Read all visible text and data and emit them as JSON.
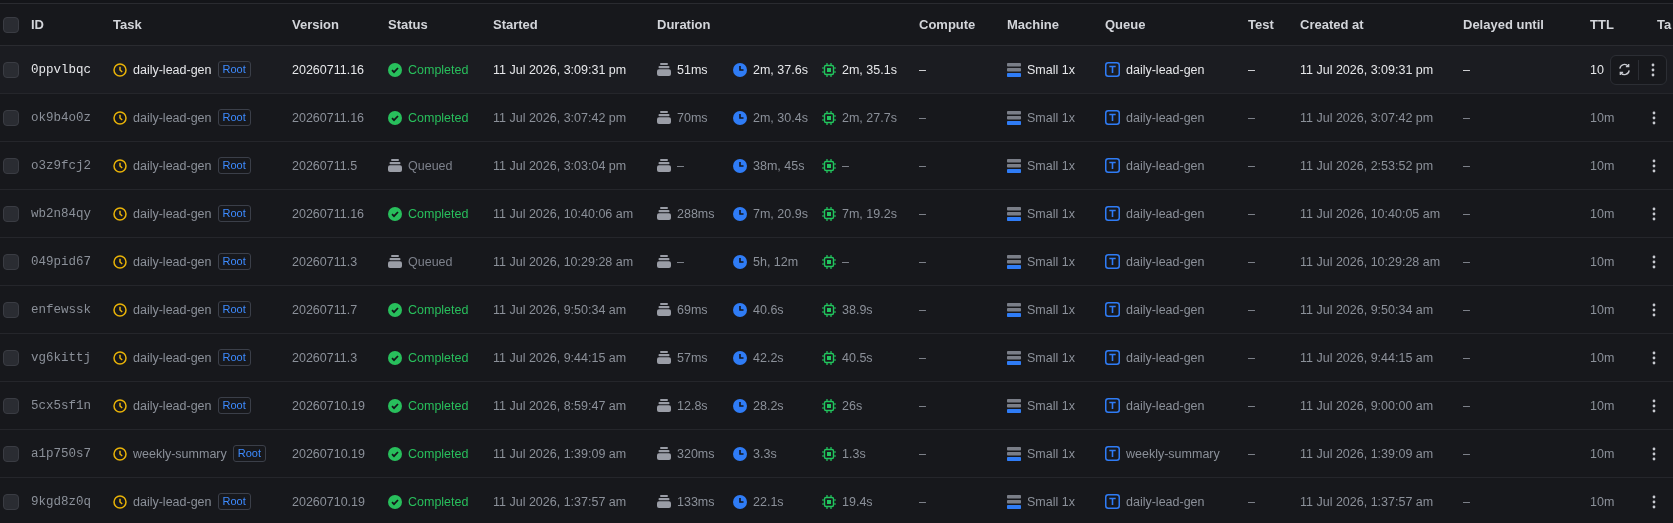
{
  "header": {
    "select_all": {
      "checked": false
    },
    "columns": [
      "ID",
      "Task",
      "Version",
      "Status",
      "Started",
      "Duration",
      "Compute",
      "Machine",
      "Queue",
      "Test",
      "Created at",
      "Delayed until",
      "TTL",
      "Ta"
    ]
  },
  "rows": [
    {
      "hovered": true,
      "checked": false,
      "id": "0ppvlbqc",
      "task": "daily-lead-gen",
      "task_tag": "Root",
      "version": "20260711.16",
      "status": {
        "kind": "completed",
        "label": "Completed"
      },
      "started": "11 Jul 2026, 3:09:31 pm",
      "queued_time": "51ms",
      "run_time": "2m, 37.6s",
      "cpu_time": "2m, 35.1s",
      "compute": "–",
      "machine": "Small 1x",
      "queue": "daily-lead-gen",
      "test": "–",
      "created_at": "11 Jul 2026, 3:09:31 pm",
      "delayed_until": "–",
      "ttl": "10"
    },
    {
      "hovered": false,
      "checked": false,
      "id": "ok9b4o0z",
      "task": "daily-lead-gen",
      "task_tag": "Root",
      "version": "20260711.16",
      "status": {
        "kind": "completed",
        "label": "Completed"
      },
      "started": "11 Jul 2026, 3:07:42 pm",
      "queued_time": "70ms",
      "run_time": "2m, 30.4s",
      "cpu_time": "2m, 27.7s",
      "compute": "–",
      "machine": "Small 1x",
      "queue": "daily-lead-gen",
      "test": "–",
      "created_at": "11 Jul 2026, 3:07:42 pm",
      "delayed_until": "–",
      "ttl": "10m"
    },
    {
      "hovered": false,
      "checked": false,
      "id": "o3z9fcj2",
      "task": "daily-lead-gen",
      "task_tag": "Root",
      "version": "20260711.5",
      "status": {
        "kind": "queued",
        "label": "Queued"
      },
      "started": "11 Jul 2026, 3:03:04 pm",
      "queued_time": "–",
      "run_time": "38m, 45s",
      "cpu_time": "–",
      "compute": "–",
      "machine": "Small 1x",
      "queue": "daily-lead-gen",
      "test": "–",
      "created_at": "11 Jul 2026, 2:53:52 pm",
      "delayed_until": "–",
      "ttl": "10m"
    },
    {
      "hovered": false,
      "checked": false,
      "id": "wb2n84qy",
      "task": "daily-lead-gen",
      "task_tag": "Root",
      "version": "20260711.16",
      "status": {
        "kind": "completed",
        "label": "Completed"
      },
      "started": "11 Jul 2026, 10:40:06 am",
      "queued_time": "288ms",
      "run_time": "7m, 20.9s",
      "cpu_time": "7m, 19.2s",
      "compute": "–",
      "machine": "Small 1x",
      "queue": "daily-lead-gen",
      "test": "–",
      "created_at": "11 Jul 2026, 10:40:05 am",
      "delayed_until": "–",
      "ttl": "10m"
    },
    {
      "hovered": false,
      "checked": false,
      "id": "049pid67",
      "task": "daily-lead-gen",
      "task_tag": "Root",
      "version": "20260711.3",
      "status": {
        "kind": "queued",
        "label": "Queued"
      },
      "started": "11 Jul 2026, 10:29:28 am",
      "queued_time": "–",
      "run_time": "5h, 12m",
      "cpu_time": "–",
      "compute": "–",
      "machine": "Small 1x",
      "queue": "daily-lead-gen",
      "test": "–",
      "created_at": "11 Jul 2026, 10:29:28 am",
      "delayed_until": "–",
      "ttl": "10m"
    },
    {
      "hovered": false,
      "checked": false,
      "id": "enfewssk",
      "task": "daily-lead-gen",
      "task_tag": "Root",
      "version": "20260711.7",
      "status": {
        "kind": "completed",
        "label": "Completed"
      },
      "started": "11 Jul 2026, 9:50:34 am",
      "queued_time": "69ms",
      "run_time": "40.6s",
      "cpu_time": "38.9s",
      "compute": "–",
      "machine": "Small 1x",
      "queue": "daily-lead-gen",
      "test": "–",
      "created_at": "11 Jul 2026, 9:50:34 am",
      "delayed_until": "–",
      "ttl": "10m"
    },
    {
      "hovered": false,
      "checked": false,
      "id": "vg6kittj",
      "task": "daily-lead-gen",
      "task_tag": "Root",
      "version": "20260711.3",
      "status": {
        "kind": "completed",
        "label": "Completed"
      },
      "started": "11 Jul 2026, 9:44:15 am",
      "queued_time": "57ms",
      "run_time": "42.2s",
      "cpu_time": "40.5s",
      "compute": "–",
      "machine": "Small 1x",
      "queue": "daily-lead-gen",
      "test": "–",
      "created_at": "11 Jul 2026, 9:44:15 am",
      "delayed_until": "–",
      "ttl": "10m"
    },
    {
      "hovered": false,
      "checked": false,
      "id": "5cx5sf1n",
      "task": "daily-lead-gen",
      "task_tag": "Root",
      "version": "20260710.19",
      "status": {
        "kind": "completed",
        "label": "Completed"
      },
      "started": "11 Jul 2026, 8:59:47 am",
      "queued_time": "12.8s",
      "run_time": "28.2s",
      "cpu_time": "26s",
      "compute": "–",
      "machine": "Small 1x",
      "queue": "daily-lead-gen",
      "test": "–",
      "created_at": "11 Jul 2026, 9:00:00 am",
      "delayed_until": "–",
      "ttl": "10m"
    },
    {
      "hovered": false,
      "checked": false,
      "id": "a1p750s7",
      "task": "weekly-summary",
      "task_tag": "Root",
      "version": "20260710.19",
      "status": {
        "kind": "completed",
        "label": "Completed"
      },
      "started": "11 Jul 2026, 1:39:09 am",
      "queued_time": "320ms",
      "run_time": "3.3s",
      "cpu_time": "1.3s",
      "compute": "–",
      "machine": "Small 1x",
      "queue": "weekly-summary",
      "test": "–",
      "created_at": "11 Jul 2026, 1:39:09 am",
      "delayed_until": "–",
      "ttl": "10m"
    },
    {
      "hovered": false,
      "checked": false,
      "id": "9kgd8z0q",
      "task": "daily-lead-gen",
      "task_tag": "Root",
      "version": "20260710.19",
      "status": {
        "kind": "completed",
        "label": "Completed"
      },
      "started": "11 Jul 2026, 1:37:57 am",
      "queued_time": "133ms",
      "run_time": "22.1s",
      "cpu_time": "19.4s",
      "compute": "–",
      "machine": "Small 1x",
      "queue": "daily-lead-gen",
      "test": "–",
      "created_at": "11 Jul 2026, 1:37:57 am",
      "delayed_until": "–",
      "ttl": "10m"
    }
  ]
}
